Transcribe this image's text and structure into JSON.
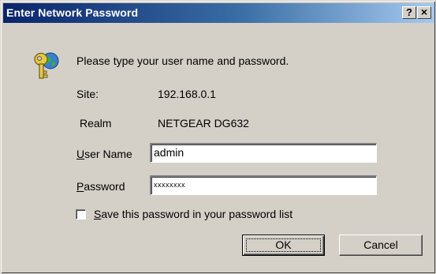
{
  "window": {
    "title": "Enter Network Password",
    "help_button": "?",
    "close_button": "×"
  },
  "dialog": {
    "prompt": "Please type your user name and password.",
    "site_label": "Site:",
    "site_value": "192.168.0.1",
    "realm_label": "Realm",
    "realm_value": "NETGEAR DG632",
    "username_label_accel": "U",
    "username_label_rest": "ser Name",
    "username_value": "admin",
    "password_label_accel": "P",
    "password_label_rest": "assword",
    "password_value": "xxxxxxxx",
    "save_checkbox_checked": false,
    "save_label_accel": "S",
    "save_label_rest": "ave this password in your password list"
  },
  "buttons": {
    "ok_label": "OK",
    "cancel_label": "Cancel"
  },
  "colors": {
    "title_gradient_start": "#0a246a",
    "title_gradient_end": "#a6caf0",
    "face": "#d4d0c8"
  },
  "icons": {
    "dialog_icon": "key-globe-icon"
  }
}
